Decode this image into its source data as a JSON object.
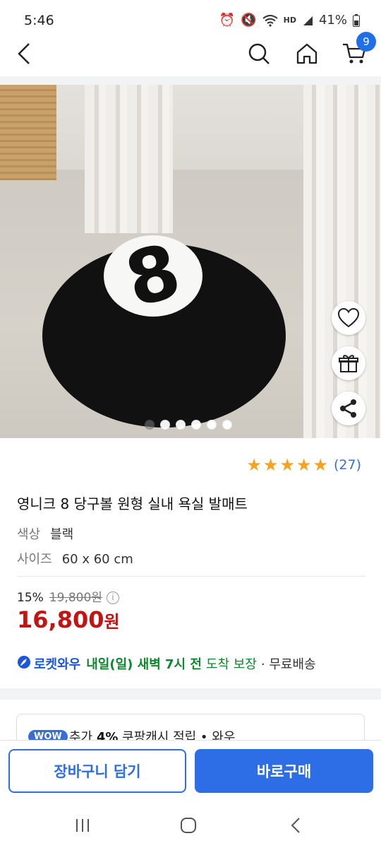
{
  "status_bar": {
    "time": "5:46",
    "battery": "41%",
    "hd_label": "HD"
  },
  "header": {
    "cart_count": "9"
  },
  "product": {
    "image_dots_count": 6,
    "rating_stars": 5,
    "review_count": "(27)",
    "title": "영니크 8 당구볼 원형 실내 욕실 발매트",
    "options": [
      {
        "key": "색상",
        "value": "블랙"
      },
      {
        "key": "사이즈",
        "value": "60 x 60 cm"
      }
    ],
    "discount_rate": "15%",
    "original_price": "19,800원",
    "price_number": "16,800",
    "price_unit": "원",
    "delivery": {
      "badge": "로켓와우",
      "date": "내일(일) 새벽 7시 전",
      "guarantee": "도착 보장",
      "free": "· 무료배송"
    }
  },
  "promo": {
    "badge": "WOW",
    "text_pre": "추가 ",
    "percent": "4%",
    "text_post": " 쿠팡캐시 적립  •  와우"
  },
  "buttons": {
    "add_to_cart": "장바구니 담기",
    "buy_now": "바로구매"
  },
  "colors": {
    "accent": "#2d6ee6",
    "price": "#c31313",
    "star": "#f6a21c",
    "rocket": "#1a58d9",
    "delivery_green": "#0a8a2a"
  }
}
